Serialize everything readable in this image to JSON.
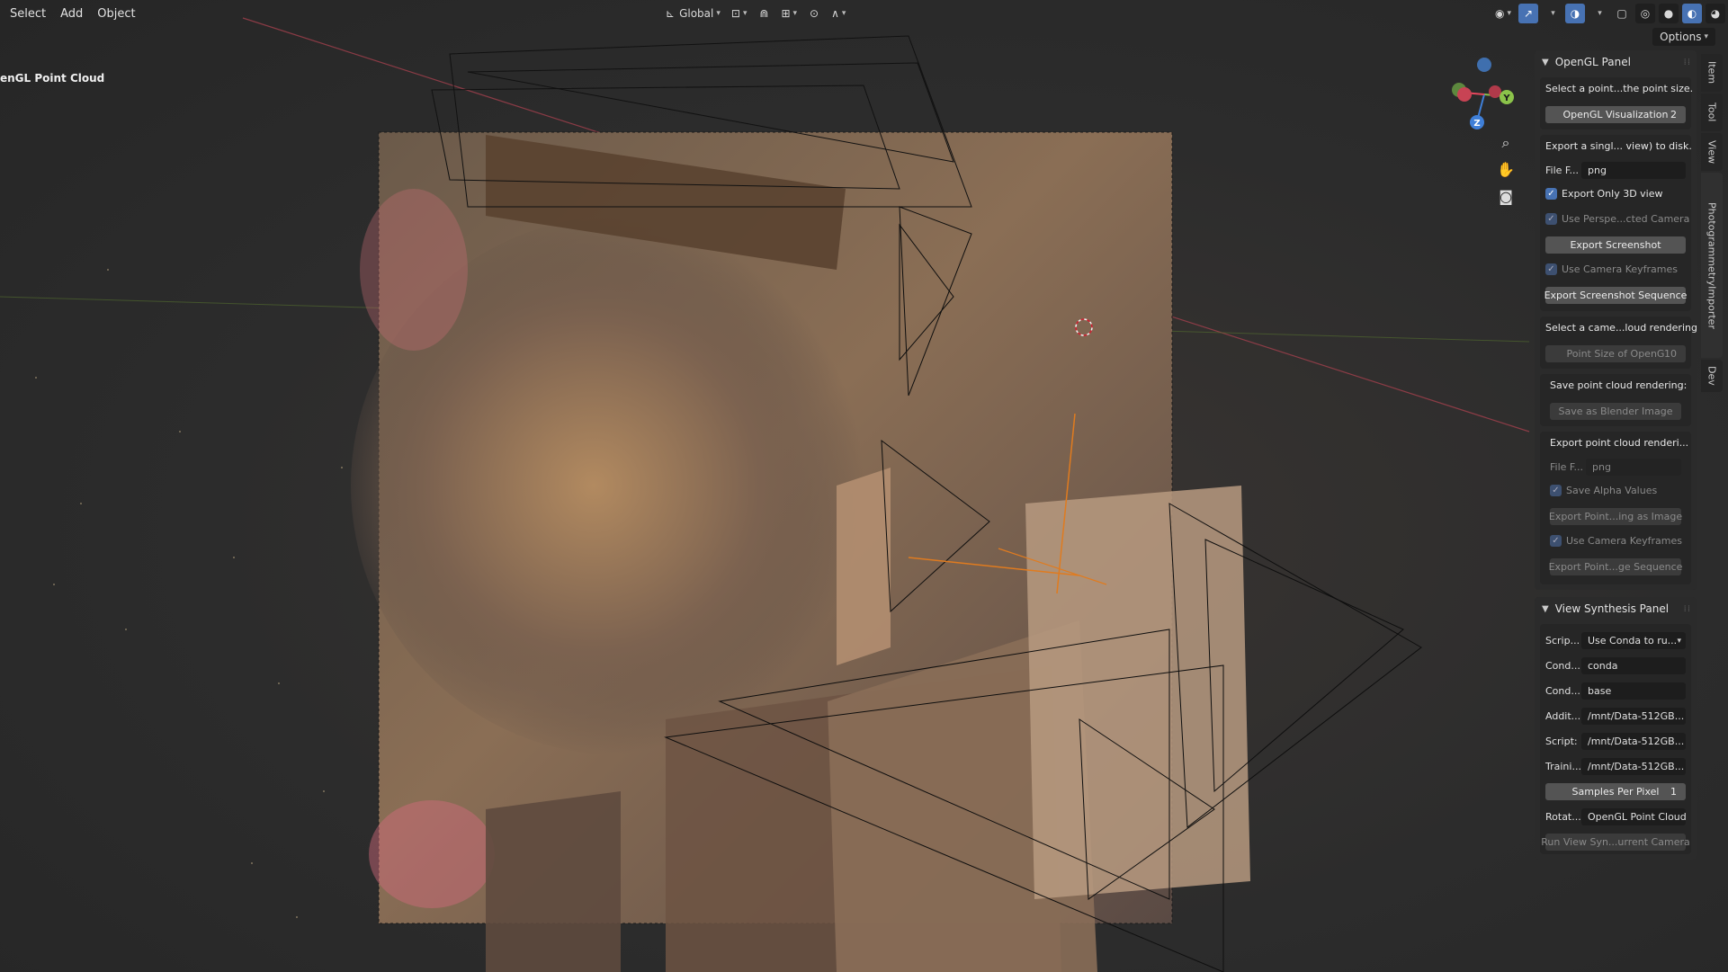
{
  "header": {
    "menus": [
      "Select",
      "Add",
      "Object"
    ],
    "transform_orientation": "Global",
    "options_label": "Options"
  },
  "viewport": {
    "title": "enGL Point Cloud"
  },
  "gizmo": {
    "x_label": "X",
    "y_label": "Y",
    "z_label": "Z",
    "tools": [
      "zoom-icon",
      "hand-icon",
      "camera-icon"
    ]
  },
  "opengl_panel": {
    "title": "OpenGL Panel",
    "select_point_text": "Select a point...the point size.",
    "opengl_vis_label": "OpenGL Visualization",
    "opengl_vis_value": "2",
    "export_single_text": "Export a singl... view) to disk.",
    "file_format_label": "File F...",
    "file_format_value": "png",
    "export_only_3d_label": "Export Only 3D view",
    "use_perspective_label": "Use Perspe...cted Camera",
    "export_screenshot_label": "Export Screenshot",
    "use_camera_keyframes_label": "Use Camera Keyframes",
    "export_sequence_label": "Export Screenshot Sequence",
    "select_camera_text": "Select a came...loud rendering",
    "point_size_label": "Point Size of OpenG",
    "point_size_value": "10",
    "save_rendering_text": "Save point cloud rendering:",
    "save_blender_image_label": "Save as Blender Image",
    "export_rendering_text": "Export point cloud renderi...",
    "file_format2_label": "File F...",
    "file_format2_value": "png",
    "save_alpha_label": "Save Alpha Values",
    "export_point_image_label": "Export Point...ing as Image",
    "use_camera_keyframes2_label": "Use Camera Keyframes",
    "export_point_sequence_label": "Export Point...ge Sequence"
  },
  "view_synthesis_panel": {
    "title": "View Synthesis Panel",
    "rows": [
      {
        "label": "Scrip...",
        "value": "Use Conda to ru...",
        "dropdown": true
      },
      {
        "label": "Cond...",
        "value": "conda"
      },
      {
        "label": "Cond...",
        "value": "base"
      },
      {
        "label": "Addit...",
        "value": "/mnt/Data-512GB..."
      },
      {
        "label": "Script:",
        "value": "/mnt/Data-512GB..."
      },
      {
        "label": "Traini...",
        "value": "/mnt/Data-512GB..."
      }
    ],
    "samples_label": "Samples Per Pixel",
    "samples_value": "1",
    "rotation_label": "Rotat...",
    "rotation_value": "OpenGL Point Cloud",
    "run_label": "Run View Syn...urrent Camera"
  },
  "side_tabs": [
    "Item",
    "Tool",
    "View",
    "PhotogrammetryImporter",
    "Dev"
  ],
  "colors": {
    "accent": "#4772b3",
    "x_axis": "#e5475d",
    "y_axis": "#8bc34a",
    "z_axis": "#3f7fd8"
  }
}
